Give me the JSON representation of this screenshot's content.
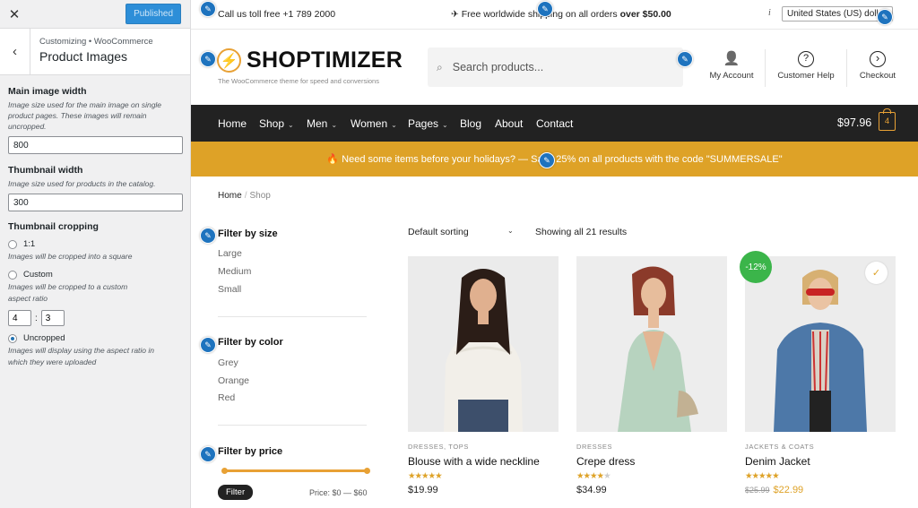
{
  "customizer": {
    "close_glyph": "✕",
    "publish_label": "Published",
    "back_glyph": "‹",
    "breadcrumb": "Customizing • WooCommerce",
    "title": "Product Images",
    "main_width": {
      "label": "Main image width",
      "description": "Image size used for the main image on single product pages. These images will remain uncropped.",
      "value": "800"
    },
    "thumb_width": {
      "label": "Thumbnail width",
      "description": "Image size used for products in the catalog.",
      "value": "300"
    },
    "cropping": {
      "label": "Thumbnail cropping",
      "options": [
        {
          "label": "1:1",
          "description": "Images will be cropped into a square",
          "checked": false
        },
        {
          "label": "Custom",
          "description": "Images will be cropped to a custom aspect ratio",
          "checked": false
        },
        {
          "label": "Uncropped",
          "description": "Images will display using the aspect ratio in which they were uploaded",
          "checked": true
        }
      ],
      "ratio_w": "4",
      "ratio_sep": ":",
      "ratio_h": "3"
    }
  },
  "topbar": {
    "call": "Call us toll free +1 789 2000",
    "shipping_prefix": "✈ Free worldwide shipping on all orders",
    "shipping_bold": "over $50.00",
    "info_glyph": "i",
    "currency": "United States (US) dollar"
  },
  "header": {
    "logo_text": "SHOPTIMIZER",
    "logo_glyph": "⚡",
    "tagline": "The WooCommerce theme for speed and conversions",
    "search_placeholder": "Search products...",
    "search_glyph": "⌕",
    "icons": [
      {
        "label": "My Account",
        "glyph": "👤"
      },
      {
        "label": "Customer Help",
        "glyph": "?"
      },
      {
        "label": "Checkout",
        "glyph": "›"
      }
    ]
  },
  "nav": {
    "items": [
      {
        "label": "Home",
        "dropdown": false
      },
      {
        "label": "Shop",
        "dropdown": true
      },
      {
        "label": "Men",
        "dropdown": true
      },
      {
        "label": "Women",
        "dropdown": true
      },
      {
        "label": "Pages",
        "dropdown": true
      },
      {
        "label": "Blog",
        "dropdown": false
      },
      {
        "label": "About",
        "dropdown": false
      },
      {
        "label": "Contact",
        "dropdown": false
      }
    ],
    "chevron": "⌄",
    "cart_total": "$97.96",
    "cart_count": "4"
  },
  "promo": {
    "text": "🔥 Need some items before your holidays? — Save 25% on all products with the code \"SUMMERSALE\""
  },
  "breadcrumb": {
    "home": "Home",
    "sep": "/",
    "current": "Shop"
  },
  "filters": {
    "size": {
      "title": "Filter by size",
      "options": [
        "Large",
        "Medium",
        "Small"
      ]
    },
    "color": {
      "title": "Filter by color",
      "options": [
        "Grey",
        "Orange",
        "Red"
      ]
    },
    "price": {
      "title": "Filter by price",
      "button": "Filter",
      "range": "Price: $0 — $60"
    }
  },
  "catalog": {
    "sorting": "Default sorting",
    "result_count": "Showing all 21 results",
    "sale_badge": "-12%",
    "wishlist_glyph": "✓",
    "products": [
      {
        "category": "DRESSES, TOPS",
        "name": "Blouse with a wide neckline",
        "rating": 5,
        "price": "$19.99",
        "old_price": ""
      },
      {
        "category": "DRESSES",
        "name": "Crepe dress",
        "rating": 4,
        "price": "$34.99",
        "old_price": ""
      },
      {
        "category": "JACKETS & COATS",
        "name": "Denim Jacket",
        "rating": 5,
        "price": "$22.99",
        "old_price": "$25.99"
      }
    ]
  },
  "pencil_glyph": "✎",
  "colors": {
    "accent": "#dea227",
    "nav_bg": "#222222",
    "edit_blue": "#1e73be",
    "sale_green": "#3bb54a",
    "publish_blue": "#2d8ed8"
  }
}
